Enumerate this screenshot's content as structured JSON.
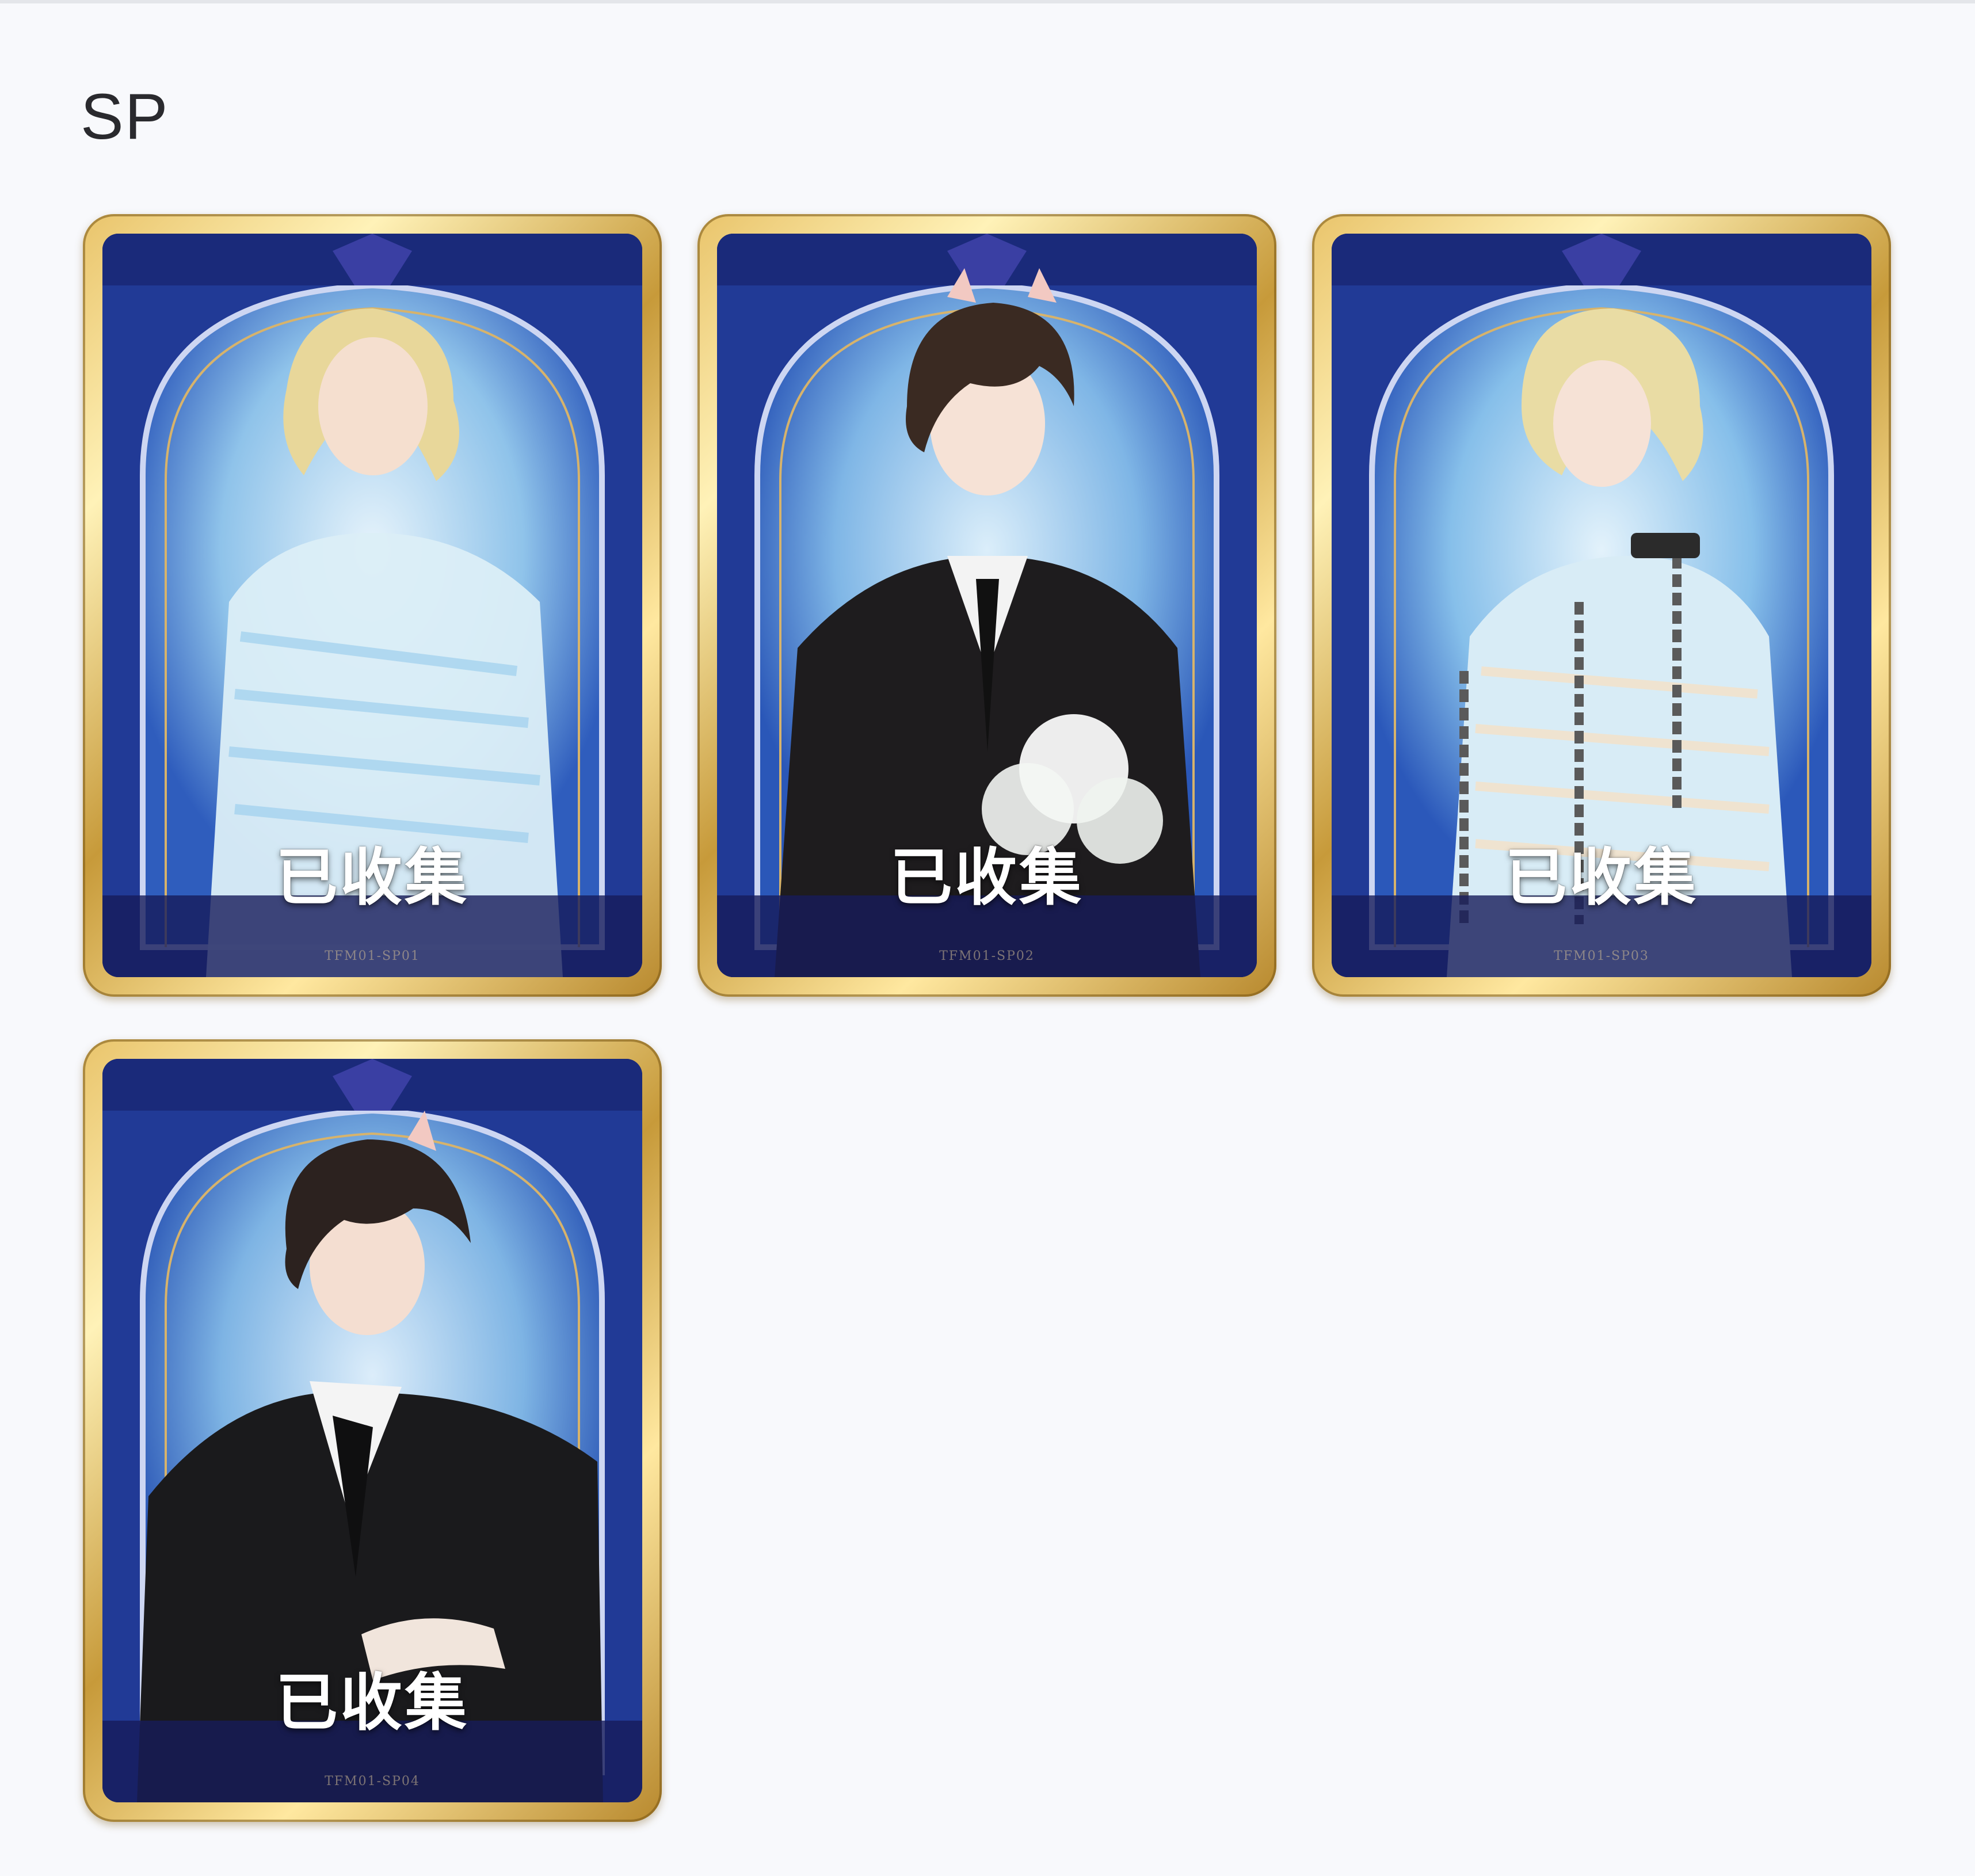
{
  "section": {
    "title": "SP"
  },
  "cards": [
    {
      "status": "已收集",
      "code": "TFM01-SP01",
      "hair_color": "#e8d79a",
      "outfit_color": "#dbeef7",
      "accent_color": "#9fd0ee"
    },
    {
      "status": "已收集",
      "code": "TFM01-SP02",
      "hair_color": "#3a2a22",
      "outfit_color": "#1e1c1e",
      "accent_color": "#ffffff"
    },
    {
      "status": "已收集",
      "code": "TFM01-SP03",
      "hair_color": "#e9dca4",
      "outfit_color": "#d8ecf6",
      "accent_color": "#5a5a5a"
    },
    {
      "status": "已收集",
      "code": "TFM01-SP04",
      "hair_color": "#2c221f",
      "outfit_color": "#1a1a1c",
      "accent_color": "#f4f4f4"
    }
  ],
  "colors": {
    "frame_gold": "#d9b35a",
    "card_blue": "#2b4fb0",
    "card_navy": "#1b1f60"
  }
}
